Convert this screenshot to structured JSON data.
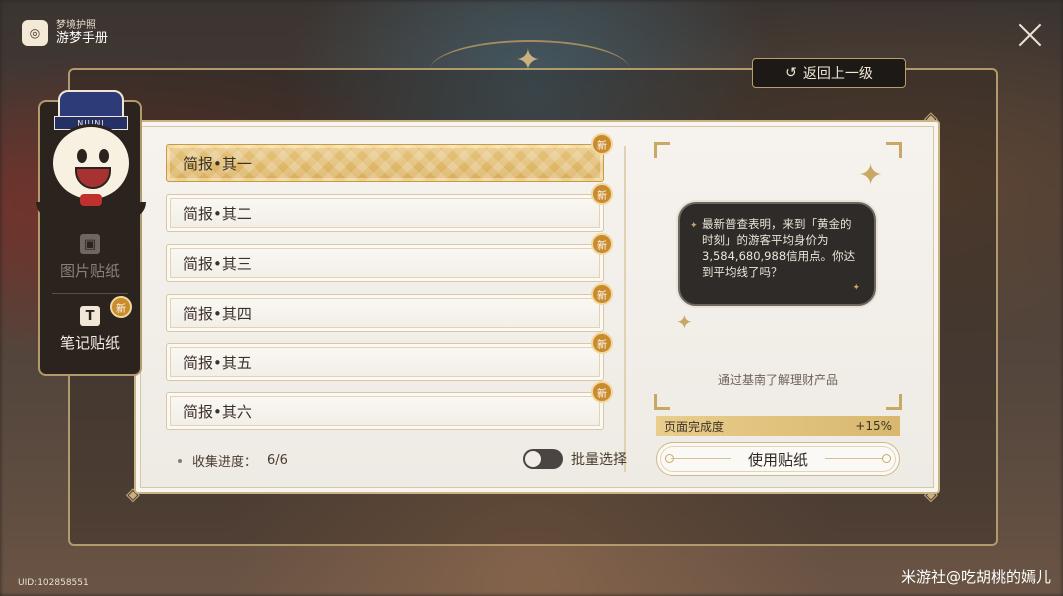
{
  "brand": {
    "subtitle": "梦境护照",
    "title": "游梦手册",
    "logo_glyph": "◎"
  },
  "header": {
    "back_label": "返回上一级",
    "back_icon": "↺"
  },
  "sidebar": {
    "mascot_hat_text": "NIUNI",
    "items": [
      {
        "label": "图片贴纸",
        "icon": "photo-sticker-icon",
        "active": false
      },
      {
        "label": "笔记贴纸",
        "icon": "note-sticker-icon",
        "active": true,
        "badge": "新"
      }
    ]
  },
  "list": {
    "items": [
      {
        "label": "简报•其一",
        "badge": "新",
        "selected": true
      },
      {
        "label": "简报•其二",
        "badge": "新",
        "selected": false
      },
      {
        "label": "简报•其三",
        "badge": "新",
        "selected": false
      },
      {
        "label": "简报•其四",
        "badge": "新",
        "selected": false
      },
      {
        "label": "简报•其五",
        "badge": "新",
        "selected": false
      },
      {
        "label": "简报•其六",
        "badge": "新",
        "selected": false
      }
    ],
    "progress_label": "收集进度：",
    "progress_value": "6/6",
    "batch_label": "批量选择",
    "batch_enabled": false
  },
  "preview": {
    "bubble_text": "最新普查表明，来到「黄金的时刻」的游客平均身价为3,584,680,988信用点。你达到平均线了吗？",
    "caption": "通过基南了解理财产品",
    "completion_label": "页面完成度",
    "completion_value": "+15%",
    "use_button_label": "使用贴纸"
  },
  "footer": {
    "uid": "UID:102858551",
    "watermark": "米游社@吃胡桃的嫣儿"
  },
  "colors": {
    "accent_gold": "#d8ad59",
    "badge_orange": "#c98b2c",
    "panel_dark": "#2a231e"
  }
}
